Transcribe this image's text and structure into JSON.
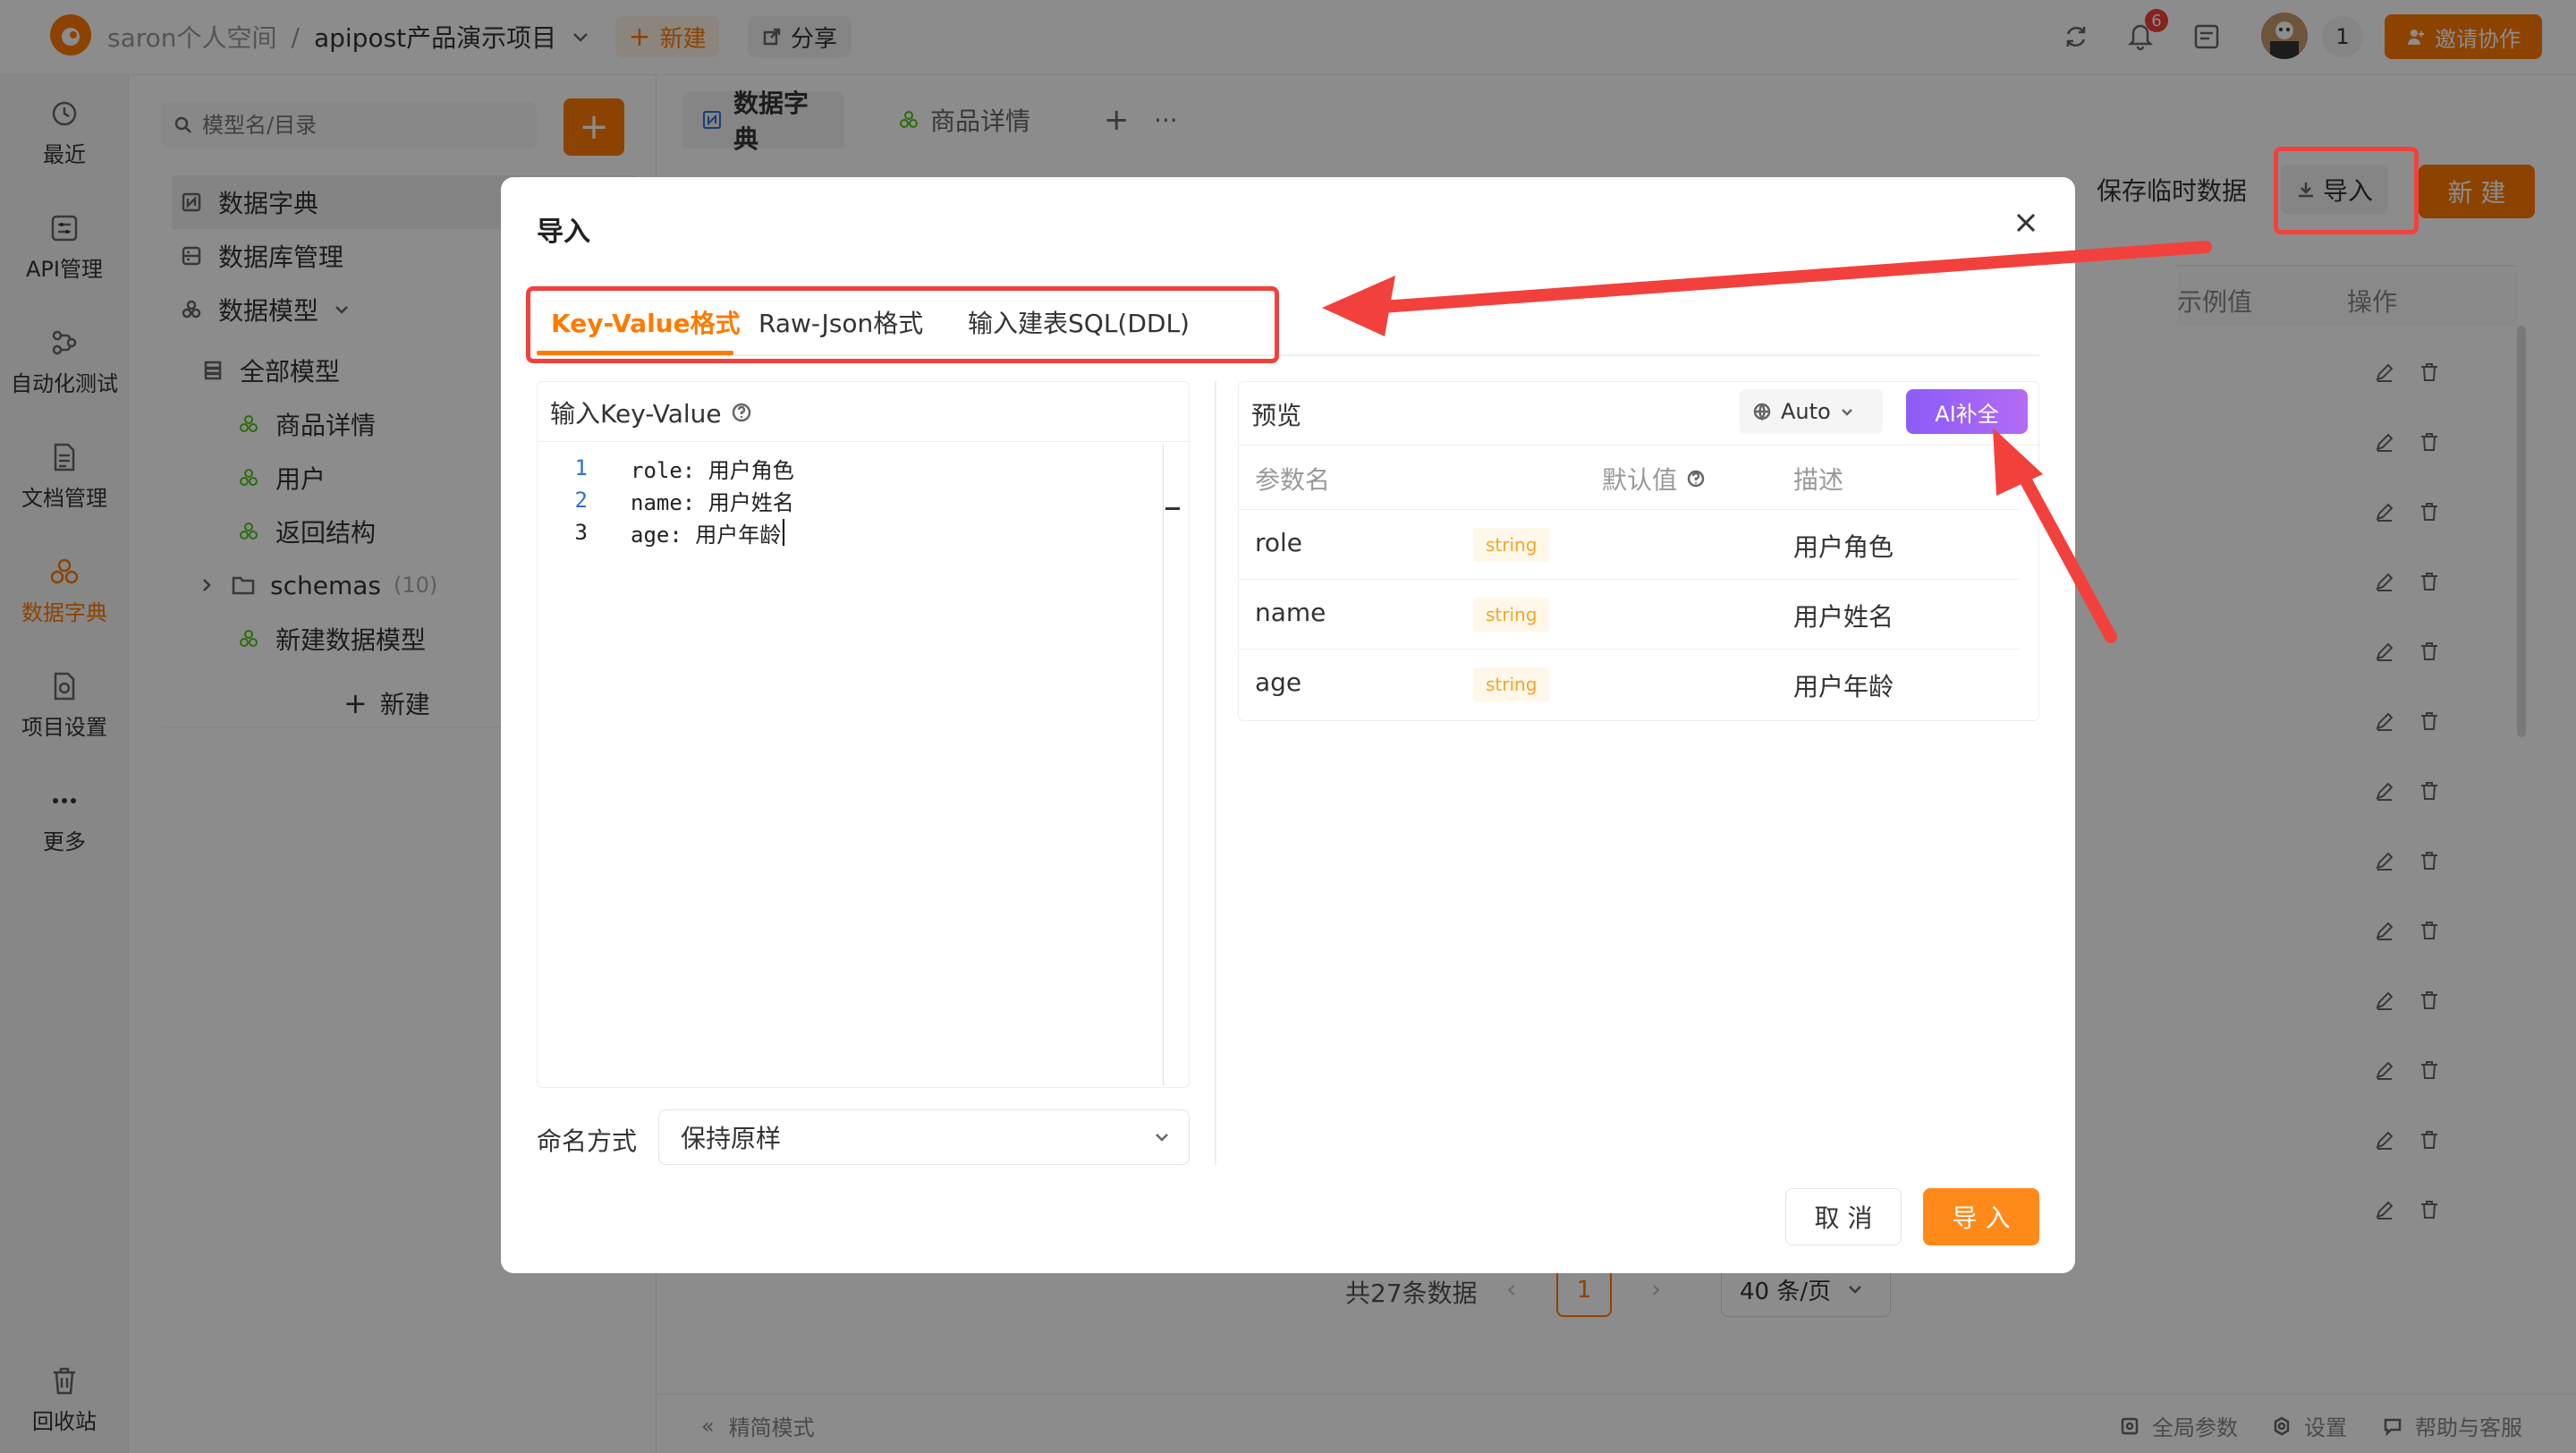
{
  "topbar": {
    "workspace": "saron个人空间",
    "separator": "/",
    "project": "apipost产品演示项目",
    "new_label": "新建",
    "share_label": "分享",
    "notif_count": "6",
    "member_count": "1",
    "invite_label": "邀请协作"
  },
  "nav": {
    "items": [
      {
        "label": "最近"
      },
      {
        "label": "API管理"
      },
      {
        "label": "自动化测试"
      },
      {
        "label": "文档管理"
      },
      {
        "label": "数据字典"
      },
      {
        "label": "项目设置"
      },
      {
        "label": "更多"
      }
    ],
    "recycle": "回收站"
  },
  "tree": {
    "search_placeholder": "模型名/目录",
    "items": [
      {
        "label": "数据字典"
      },
      {
        "label": "数据库管理"
      },
      {
        "label": "数据模型"
      },
      {
        "label": "全部模型"
      },
      {
        "label": "商品详情"
      },
      {
        "label": "用户"
      },
      {
        "label": "返回结构"
      },
      {
        "label": "schemas"
      },
      {
        "label": "新建数据模型"
      }
    ],
    "schemas_count": "(10)",
    "new_label": "新建"
  },
  "main": {
    "tabs": [
      {
        "label": "数据字典"
      },
      {
        "label": "商品详情"
      }
    ],
    "save_temp": "保存临时数据",
    "import_label": "导入",
    "new_label": "新 建",
    "col_example": "示例值",
    "col_ops": "操作",
    "pagination": {
      "total": "共27条数据",
      "page": "1",
      "per_page": "40 条/页"
    },
    "footer": {
      "simple_mode": "精简模式",
      "global_params": "全局参数",
      "settings": "设置",
      "help": "帮助与客服"
    }
  },
  "modal": {
    "title": "导入",
    "tabs": [
      {
        "label": "Key-Value格式"
      },
      {
        "label": "Raw-Json格式"
      },
      {
        "label": "输入建表SQL(DDL)"
      }
    ],
    "input_title": "输入Key-Value",
    "code_lines": [
      {
        "num": "1",
        "text": "role: 用户角色"
      },
      {
        "num": "2",
        "text": "name: 用户姓名"
      },
      {
        "num": "3",
        "text": "age: 用户年龄"
      }
    ],
    "naming_label": "命名方式",
    "naming_value": "保持原样",
    "preview_title": "预览",
    "auto_label": "Auto",
    "ai_label": "AI补全",
    "col_name": "参数名",
    "col_default": "默认值",
    "col_desc": "描述",
    "rows": [
      {
        "name": "role",
        "type": "string",
        "desc": "用户角色"
      },
      {
        "name": "name",
        "type": "string",
        "desc": "用户姓名"
      },
      {
        "name": "age",
        "type": "string",
        "desc": "用户年龄"
      }
    ],
    "cancel_label": "取 消",
    "confirm_label": "导 入"
  },
  "colors": {
    "accent": "#ff7a00",
    "annotation_red": "#f2413d",
    "ai_purple": "#8b5cf6",
    "string_tag": "#f5a623"
  }
}
